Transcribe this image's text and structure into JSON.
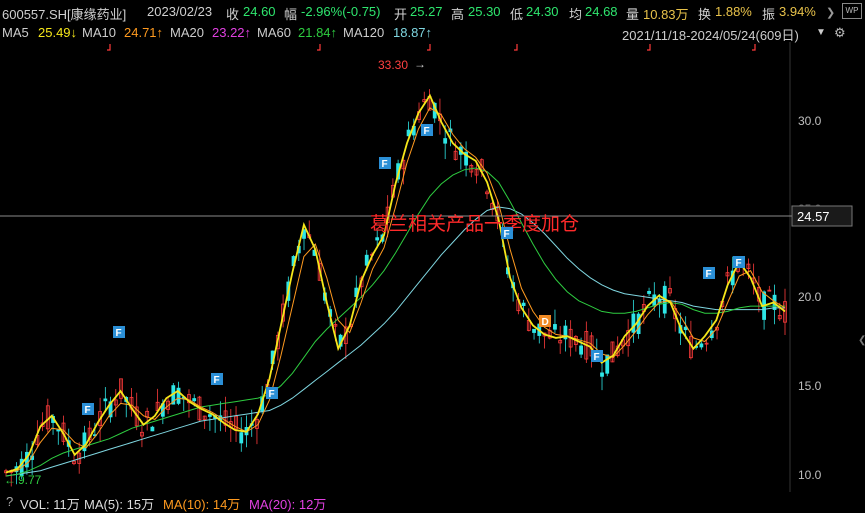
{
  "header": {
    "symbol": "600557.SH[康缘药业]",
    "date": "2023/02/23",
    "close_label": "收",
    "close": "24.60",
    "change_label": "幅",
    "change": "-2.96%(-0.75)",
    "open_label": "开",
    "open": "25.27",
    "high_label": "高",
    "high": "25.30",
    "low_label": "低",
    "low": "24.30",
    "avg_label": "均",
    "avg": "24.68",
    "volume_label": "量",
    "volume": "10.83万",
    "turnover_label": "换",
    "turnover": "1.88%",
    "amplitude_label": "振",
    "amplitude": "3.94%"
  },
  "ma": {
    "ma5_label": "MA5",
    "ma5": "25.49↓",
    "ma10_label": "MA10",
    "ma10": "24.71↑",
    "ma20_label": "MA20",
    "ma20": "23.22↑",
    "ma60_label": "MA60",
    "ma60": "21.84↑",
    "ma120_label": "MA120",
    "ma120": "18.87↑",
    "range": "2021/11/18-2024/05/24(609日)",
    "dropdown_icon": "triangle-down"
  },
  "colors": {
    "ma5": "#f5e61a",
    "ma10": "#ff9a1f",
    "ma20": "#e040e0",
    "ma60": "#2ecc40",
    "ma120": "#7fd6e0",
    "up": "#ff3b3b",
    "down": "#2ee6e6",
    "annotation": "#ff2a2a"
  },
  "chart": {
    "y_ticks": [
      "30.0",
      "25.0",
      "20.0",
      "15.0",
      "10.0"
    ],
    "crosshair_value": "24.57",
    "max_label": "33.30",
    "min_label": "9.77",
    "annotation": "葛兰相关产品一季度加仓",
    "flags": [
      "F",
      "F",
      "F",
      "F",
      "F",
      "F",
      "F",
      "D",
      "F",
      "F",
      "F"
    ]
  },
  "chart_data": {
    "type": "line",
    "title": "",
    "ylim": [
      9.5,
      34
    ],
    "y_ticks": [
      30,
      25,
      20,
      15,
      10
    ],
    "series": [
      {
        "name": "MA5",
        "values": [
          10.2,
          10.4,
          11.2,
          12.8,
          13.4,
          12.4,
          11.2,
          11.8,
          13.0,
          14.0,
          14.8,
          13.8,
          12.9,
          13.4,
          14.4,
          14.8,
          14.2,
          13.8,
          13.5,
          13.0,
          12.6,
          12.5,
          13.5,
          15.5,
          18.5,
          21.5,
          24.2,
          22.8,
          19.8,
          17.2,
          18.5,
          21.0,
          22.5,
          23.6,
          26.5,
          28.8,
          30.5,
          31.5,
          30.0,
          28.8,
          28.2,
          27.8,
          26.6,
          24.5,
          21.2,
          19.5,
          18.5,
          18.0,
          17.8,
          17.9,
          17.6,
          17.3,
          16.4,
          16.8,
          17.9,
          18.6,
          19.6,
          20.2,
          19.8,
          18.2,
          17.2,
          17.9,
          18.8,
          20.8,
          22.1,
          21.2,
          19.6,
          19.8,
          19.3
        ]
      },
      {
        "name": "MA10",
        "values": [
          10.2,
          10.3,
          10.8,
          11.9,
          12.7,
          12.6,
          11.9,
          11.6,
          12.4,
          13.4,
          14.1,
          14.0,
          13.4,
          13.2,
          13.9,
          14.4,
          14.3,
          13.9,
          13.6,
          13.2,
          12.8,
          12.5,
          12.9,
          14.3,
          16.8,
          19.6,
          22.4,
          23.1,
          21.2,
          18.8,
          18.1,
          19.8,
          21.7,
          22.9,
          25.2,
          27.7,
          29.6,
          30.8,
          30.4,
          29.3,
          28.5,
          28.0,
          27.1,
          25.4,
          22.8,
          20.6,
          19.3,
          18.4,
          18.0,
          17.9,
          17.7,
          17.5,
          16.9,
          16.7,
          17.4,
          18.2,
          19.1,
          19.8,
          19.9,
          18.9,
          17.8,
          17.6,
          18.3,
          19.8,
          21.3,
          21.6,
          20.4,
          19.9,
          19.5
        ]
      },
      {
        "name": "MA60",
        "values": [
          10.0,
          10.1,
          10.3,
          10.6,
          11.0,
          11.3,
          11.5,
          11.7,
          11.9,
          12.1,
          12.4,
          12.7,
          12.9,
          13.1,
          13.3,
          13.5,
          13.7,
          13.9,
          14.0,
          14.1,
          14.2,
          14.3,
          14.4,
          14.6,
          15.1,
          15.8,
          16.7,
          17.6,
          18.3,
          18.9,
          19.5,
          20.1,
          20.8,
          21.6,
          22.6,
          23.7,
          24.8,
          25.8,
          26.5,
          27.0,
          27.3,
          27.4,
          27.2,
          26.6,
          25.5,
          24.3,
          23.1,
          22.0,
          21.1,
          20.4,
          19.9,
          19.6,
          19.3,
          19.2,
          19.2,
          19.3,
          19.5,
          19.7,
          19.8,
          19.7,
          19.4,
          19.2,
          19.2,
          19.3,
          19.5,
          19.6,
          19.6,
          19.6,
          19.6
        ]
      },
      {
        "name": "MA120",
        "values": [
          10.0,
          10.1,
          10.2,
          10.3,
          10.5,
          10.7,
          10.9,
          11.1,
          11.3,
          11.5,
          11.7,
          11.9,
          12.1,
          12.3,
          12.5,
          12.7,
          12.9,
          13.1,
          13.2,
          13.3,
          13.4,
          13.5,
          13.6,
          13.7,
          14.0,
          14.4,
          14.9,
          15.4,
          15.9,
          16.4,
          16.9,
          17.4,
          18.0,
          18.6,
          19.3,
          20.1,
          20.9,
          21.7,
          22.5,
          23.2,
          23.9,
          24.5,
          25.0,
          25.2,
          25.1,
          24.8,
          24.3,
          23.7,
          23.0,
          22.3,
          21.7,
          21.2,
          20.8,
          20.5,
          20.3,
          20.2,
          20.1,
          20.0,
          19.9,
          19.8,
          19.6,
          19.5,
          19.4,
          19.4,
          19.4,
          19.4,
          19.4,
          19.5,
          19.5
        ]
      }
    ]
  },
  "volume": {
    "label": "VOL: 11万",
    "ma5": "MA(5): 15万",
    "ma10": "MA(10): 14万",
    "ma20": "MA(20): 12万",
    "question": "?"
  },
  "icons": {
    "wp": "WP",
    "settings": "gear-icon"
  }
}
